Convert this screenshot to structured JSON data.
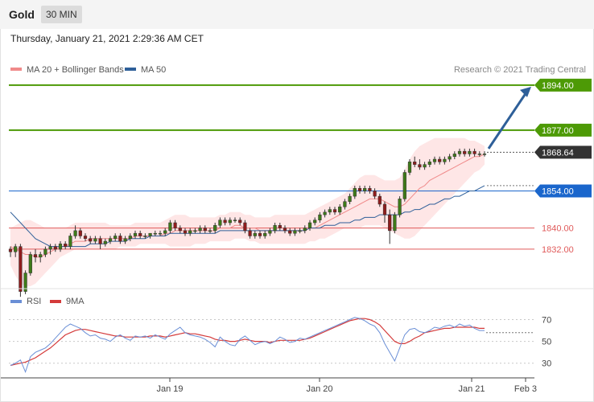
{
  "header": {
    "title": "Gold",
    "timeframe": "30 MIN"
  },
  "timestamp": "Thursday, January 21, 2021 2:29:36 AM CET",
  "legend": {
    "ma20_label": "MA 20 + Bollinger Bands",
    "ma50_label": "MA 50",
    "credit": "Research © 2021 Trading Central"
  },
  "rsi_legend": {
    "rsi_label": "RSI",
    "ma9_label": "9MA"
  },
  "colors": {
    "green_level": "#4d9a06",
    "blue_level": "#1a66cc",
    "red_level": "#e05a5a",
    "ma20": "#f08a8a",
    "ma50": "#2e5f99",
    "band": "#fddede",
    "candle_up": "#3e7a19",
    "candle_down": "#8f1c1c",
    "current": "#333333",
    "arrow": "#2e5f99",
    "rsi": "#6a8fd6",
    "rsi_ma": "#d43a3a"
  },
  "chart_data": [
    {
      "type": "candlestick",
      "title": "Gold",
      "timeframe": "30 MIN",
      "ylim": [
        1818,
        1897
      ],
      "x_ticks": [
        "Jan 19",
        "Jan 20",
        "Jan 21",
        "Feb 3"
      ],
      "levels": [
        {
          "value": 1894.0,
          "label": "1894.00",
          "kind": "resistance",
          "style": "tag"
        },
        {
          "value": 1877.0,
          "label": "1877.00",
          "kind": "resistance",
          "style": "tag"
        },
        {
          "value": 1854.0,
          "label": "1854.00",
          "kind": "pivot",
          "style": "tag"
        },
        {
          "value": 1840.0,
          "label": "1840.00",
          "kind": "support",
          "style": "text"
        },
        {
          "value": 1832.0,
          "label": "1832.00",
          "kind": "support",
          "style": "text"
        }
      ],
      "current_price": {
        "value": 1868.64,
        "label": "1868.64"
      },
      "projection_arrow": {
        "from": 1870,
        "to": 1894
      },
      "candles": [
        [
          1832,
          1833,
          1829,
          1831
        ],
        [
          1831,
          1834,
          1829,
          1833
        ],
        [
          1833,
          1834,
          1814,
          1816
        ],
        [
          1816,
          1824,
          1815,
          1823
        ],
        [
          1823,
          1831,
          1822,
          1830
        ],
        [
          1830,
          1832,
          1827,
          1829
        ],
        [
          1829,
          1831,
          1827,
          1830
        ],
        [
          1830,
          1833,
          1829,
          1832
        ],
        [
          1832,
          1834,
          1830,
          1833
        ],
        [
          1833,
          1834,
          1831,
          1832
        ],
        [
          1832,
          1835,
          1831,
          1834
        ],
        [
          1834,
          1835,
          1832,
          1833
        ],
        [
          1833,
          1838,
          1832,
          1837
        ],
        [
          1837,
          1841,
          1836,
          1839
        ],
        [
          1839,
          1840,
          1836,
          1837
        ],
        [
          1837,
          1838,
          1835,
          1836
        ],
        [
          1836,
          1837,
          1834,
          1835
        ],
        [
          1835,
          1837,
          1834,
          1836
        ],
        [
          1836,
          1837,
          1832,
          1834
        ],
        [
          1834,
          1836,
          1833,
          1835
        ],
        [
          1835,
          1837,
          1834,
          1836
        ],
        [
          1836,
          1838,
          1835,
          1837
        ],
        [
          1837,
          1838,
          1834,
          1835
        ],
        [
          1835,
          1837,
          1834,
          1836
        ],
        [
          1836,
          1838,
          1835,
          1837
        ],
        [
          1837,
          1839,
          1836,
          1838
        ],
        [
          1838,
          1839,
          1836,
          1837
        ],
        [
          1837,
          1838,
          1836,
          1837
        ],
        [
          1837,
          1838,
          1836,
          1838
        ],
        [
          1838,
          1839,
          1837,
          1838
        ],
        [
          1838,
          1839,
          1837,
          1838
        ],
        [
          1838,
          1840,
          1837,
          1839
        ],
        [
          1839,
          1843,
          1838,
          1842
        ],
        [
          1842,
          1843,
          1839,
          1840
        ],
        [
          1840,
          1841,
          1838,
          1839
        ],
        [
          1839,
          1840,
          1837,
          1838
        ],
        [
          1838,
          1840,
          1837,
          1839
        ],
        [
          1839,
          1840,
          1838,
          1839
        ],
        [
          1839,
          1841,
          1838,
          1840
        ],
        [
          1840,
          1841,
          1838,
          1839
        ],
        [
          1839,
          1840,
          1838,
          1839
        ],
        [
          1839,
          1842,
          1838,
          1841
        ],
        [
          1841,
          1844,
          1840,
          1843
        ],
        [
          1843,
          1844,
          1841,
          1842
        ],
        [
          1842,
          1844,
          1841,
          1843
        ],
        [
          1843,
          1844,
          1842,
          1843
        ],
        [
          1843,
          1844,
          1841,
          1842
        ],
        [
          1842,
          1843,
          1838,
          1839
        ],
        [
          1839,
          1840,
          1836,
          1837
        ],
        [
          1837,
          1839,
          1836,
          1838
        ],
        [
          1838,
          1839,
          1836,
          1837
        ],
        [
          1837,
          1839,
          1836,
          1838
        ],
        [
          1838,
          1840,
          1837,
          1839
        ],
        [
          1839,
          1842,
          1838,
          1841
        ],
        [
          1841,
          1842,
          1839,
          1840
        ],
        [
          1840,
          1841,
          1838,
          1839
        ],
        [
          1839,
          1840,
          1837,
          1838
        ],
        [
          1838,
          1840,
          1837,
          1839
        ],
        [
          1839,
          1840,
          1838,
          1839
        ],
        [
          1839,
          1841,
          1838,
          1840
        ],
        [
          1840,
          1843,
          1839,
          1842
        ],
        [
          1842,
          1844,
          1841,
          1843
        ],
        [
          1843,
          1846,
          1842,
          1845
        ],
        [
          1845,
          1847,
          1844,
          1846
        ],
        [
          1846,
          1848,
          1845,
          1847
        ],
        [
          1847,
          1848,
          1845,
          1846
        ],
        [
          1846,
          1849,
          1845,
          1848
        ],
        [
          1848,
          1851,
          1847,
          1850
        ],
        [
          1850,
          1853,
          1849,
          1852
        ],
        [
          1852,
          1856,
          1851,
          1855
        ],
        [
          1855,
          1856,
          1853,
          1854
        ],
        [
          1854,
          1856,
          1853,
          1855
        ],
        [
          1855,
          1856,
          1853,
          1854
        ],
        [
          1854,
          1855,
          1851,
          1852
        ],
        [
          1852,
          1853,
          1848,
          1849
        ],
        [
          1849,
          1850,
          1842,
          1845
        ],
        [
          1845,
          1847,
          1834,
          1839
        ],
        [
          1839,
          1846,
          1838,
          1845
        ],
        [
          1845,
          1852,
          1844,
          1851
        ],
        [
          1851,
          1862,
          1850,
          1861
        ],
        [
          1861,
          1866,
          1860,
          1865
        ],
        [
          1865,
          1867,
          1863,
          1864
        ],
        [
          1864,
          1866,
          1862,
          1863
        ],
        [
          1863,
          1865,
          1862,
          1864
        ],
        [
          1864,
          1866,
          1863,
          1865
        ],
        [
          1865,
          1867,
          1864,
          1866
        ],
        [
          1866,
          1867,
          1864,
          1865
        ],
        [
          1865,
          1867,
          1864,
          1866
        ],
        [
          1866,
          1868,
          1865,
          1867
        ],
        [
          1867,
          1869,
          1866,
          1868
        ],
        [
          1868,
          1870,
          1867,
          1869
        ],
        [
          1869,
          1870,
          1867,
          1868
        ],
        [
          1868,
          1870,
          1867,
          1869
        ],
        [
          1869,
          1870,
          1867,
          1868
        ],
        [
          1868,
          1869,
          1867,
          1868
        ],
        [
          1868,
          1869,
          1867,
          1868
        ]
      ],
      "ma20": [
        1833,
        1832,
        1831,
        1830,
        1830,
        1829,
        1829,
        1830,
        1831,
        1832,
        1833,
        1833,
        1834,
        1835,
        1835,
        1835,
        1836,
        1836,
        1836,
        1836,
        1836,
        1836,
        1836,
        1836,
        1836,
        1837,
        1837,
        1837,
        1837,
        1837,
        1837,
        1838,
        1838,
        1839,
        1839,
        1839,
        1839,
        1839,
        1839,
        1839,
        1839,
        1839,
        1840,
        1840,
        1840,
        1841,
        1841,
        1840,
        1840,
        1840,
        1839,
        1839,
        1839,
        1839,
        1839,
        1839,
        1839,
        1839,
        1839,
        1839,
        1840,
        1840,
        1841,
        1842,
        1843,
        1844,
        1845,
        1846,
        1847,
        1848,
        1849,
        1850,
        1851,
        1851,
        1851,
        1850,
        1849,
        1848,
        1848,
        1849,
        1851,
        1853,
        1855,
        1856,
        1858,
        1859,
        1860,
        1861,
        1862,
        1863,
        1864,
        1865,
        1866,
        1867,
        1867,
        1868
      ],
      "bb_upper": [
        1840,
        1841,
        1842,
        1843,
        1843,
        1842,
        1841,
        1840,
        1840,
        1840,
        1840,
        1840,
        1841,
        1842,
        1842,
        1842,
        1842,
        1842,
        1842,
        1842,
        1841,
        1841,
        1841,
        1841,
        1841,
        1842,
        1842,
        1842,
        1842,
        1842,
        1842,
        1843,
        1844,
        1845,
        1845,
        1845,
        1844,
        1844,
        1844,
        1844,
        1844,
        1844,
        1845,
        1845,
        1846,
        1846,
        1846,
        1845,
        1845,
        1844,
        1844,
        1844,
        1844,
        1845,
        1845,
        1845,
        1845,
        1845,
        1845,
        1845,
        1846,
        1847,
        1848,
        1849,
        1850,
        1851,
        1852,
        1853,
        1855,
        1857,
        1859,
        1860,
        1860,
        1860,
        1859,
        1858,
        1858,
        1858,
        1859,
        1862,
        1866,
        1869,
        1871,
        1872,
        1873,
        1874,
        1874,
        1874,
        1874,
        1874,
        1874,
        1874,
        1873,
        1873,
        1872,
        1871
      ],
      "bb_lower": [
        1826,
        1822,
        1819,
        1818,
        1818,
        1819,
        1821,
        1823,
        1825,
        1827,
        1829,
        1830,
        1831,
        1832,
        1832,
        1832,
        1832,
        1832,
        1832,
        1832,
        1832,
        1832,
        1833,
        1833,
        1833,
        1833,
        1834,
        1834,
        1834,
        1834,
        1834,
        1834,
        1833,
        1833,
        1833,
        1833,
        1833,
        1834,
        1834,
        1834,
        1835,
        1835,
        1835,
        1835,
        1835,
        1836,
        1836,
        1836,
        1835,
        1835,
        1834,
        1834,
        1834,
        1834,
        1834,
        1834,
        1834,
        1834,
        1834,
        1834,
        1835,
        1835,
        1836,
        1836,
        1837,
        1838,
        1839,
        1840,
        1840,
        1840,
        1840,
        1841,
        1841,
        1841,
        1841,
        1840,
        1839,
        1838,
        1837,
        1836,
        1836,
        1837,
        1839,
        1841,
        1843,
        1845,
        1847,
        1849,
        1851,
        1853,
        1855,
        1857,
        1859,
        1861,
        1862,
        1864
      ],
      "ma50": [
        1846,
        1844,
        1842,
        1840,
        1838,
        1836,
        1835,
        1834,
        1833,
        1833,
        1833,
        1833,
        1833,
        1833,
        1833,
        1833,
        1834,
        1834,
        1834,
        1834,
        1835,
        1835,
        1835,
        1835,
        1836,
        1836,
        1836,
        1836,
        1837,
        1837,
        1837,
        1837,
        1838,
        1838,
        1838,
        1838,
        1838,
        1838,
        1838,
        1838,
        1838,
        1838,
        1839,
        1839,
        1839,
        1839,
        1839,
        1839,
        1839,
        1839,
        1839,
        1839,
        1839,
        1839,
        1839,
        1839,
        1839,
        1839,
        1839,
        1839,
        1840,
        1840,
        1840,
        1841,
        1841,
        1841,
        1842,
        1842,
        1842,
        1843,
        1843,
        1844,
        1844,
        1844,
        1845,
        1845,
        1845,
        1845,
        1845,
        1846,
        1846,
        1847,
        1847,
        1848,
        1849,
        1849,
        1850,
        1851,
        1851,
        1852,
        1852,
        1853,
        1854,
        1854,
        1855,
        1856
      ]
    },
    {
      "type": "line",
      "title": "RSI",
      "ylim": [
        18,
        80
      ],
      "y_ticks": [
        30,
        50,
        70
      ],
      "x_ticks": [
        "Jan 19",
        "Jan 20",
        "Jan 21",
        "Feb 3"
      ],
      "current_level": 58,
      "series": [
        {
          "name": "RSI",
          "values": [
            28,
            30,
            33,
            22,
            36,
            40,
            42,
            44,
            48,
            53,
            58,
            63,
            66,
            64,
            62,
            58,
            55,
            56,
            53,
            52,
            50,
            54,
            56,
            53,
            51,
            55,
            54,
            55,
            53,
            56,
            54,
            52,
            57,
            60,
            63,
            58,
            56,
            55,
            54,
            52,
            49,
            45,
            54,
            50,
            47,
            46,
            52,
            55,
            51,
            47,
            49,
            50,
            48,
            50,
            54,
            52,
            49,
            50,
            53,
            52,
            54,
            56,
            58,
            60,
            62,
            64,
            66,
            68,
            70,
            72,
            71,
            69,
            66,
            64,
            58,
            48,
            40,
            32,
            44,
            56,
            61,
            62,
            59,
            58,
            60,
            63,
            62,
            64,
            65,
            63,
            66,
            64,
            65,
            62,
            60,
            60
          ]
        },
        {
          "name": "9MA",
          "values": [
            28,
            29,
            30,
            31,
            33,
            35,
            38,
            41,
            44,
            48,
            52,
            56,
            58,
            60,
            61,
            61,
            60,
            59,
            58,
            57,
            56,
            55,
            55,
            54,
            54,
            54,
            54,
            54,
            55,
            55,
            55,
            54,
            55,
            56,
            57,
            58,
            57,
            57,
            56,
            55,
            54,
            52,
            51,
            51,
            50,
            50,
            51,
            52,
            51,
            50,
            50,
            50,
            49,
            50,
            51,
            51,
            51,
            51,
            51,
            52,
            53,
            55,
            57,
            59,
            61,
            63,
            65,
            67,
            69,
            70,
            71,
            71,
            70,
            68,
            65,
            60,
            55,
            50,
            48,
            48,
            50,
            53,
            55,
            58,
            59,
            60,
            61,
            62,
            62,
            63,
            63,
            63,
            63,
            63,
            62,
            62
          ]
        }
      ]
    }
  ]
}
